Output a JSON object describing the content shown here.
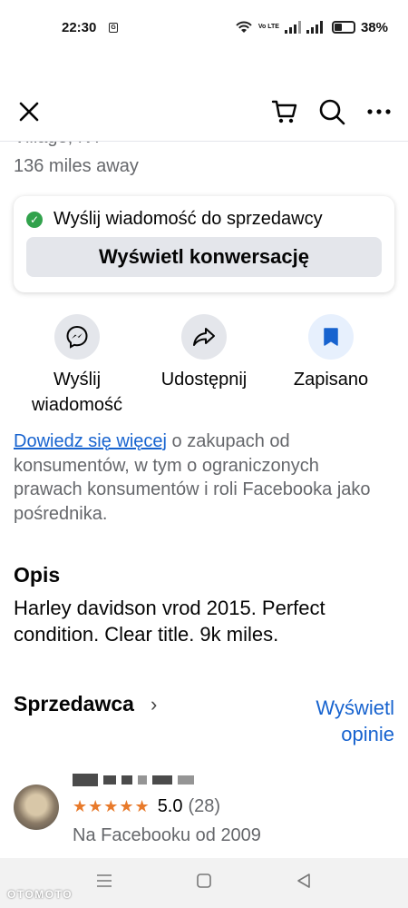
{
  "status_bar": {
    "time": "22:30",
    "sim_badge": "G",
    "network": "Vo LTE",
    "battery": "38%"
  },
  "top_bar": {
    "close": "close-icon",
    "cart": "cart-icon",
    "search": "search-icon",
    "more": "more-icon"
  },
  "listing": {
    "location": "Village, NY",
    "distance": "136 miles away"
  },
  "message_card": {
    "status_text": "Wyślij wiadomość do sprzedawcy",
    "button_label": "Wyświetl konwersację"
  },
  "actions": [
    {
      "label_line1": "Wyślij",
      "label_line2": "wiadomość",
      "icon": "messenger-icon"
    },
    {
      "label_line1": "Udostępnij",
      "label_line2": "",
      "icon": "share-icon"
    },
    {
      "label_line1": "Zapisano",
      "label_line2": "",
      "icon": "bookmark-icon"
    }
  ],
  "info": {
    "link_text": "Dowiedz się więcej",
    "text": " o zakupach od konsumentów, w tym o ograniczonych prawach konsumentów i roli Facebooka jako pośrednika."
  },
  "description": {
    "title": "Opis",
    "body": "Harley davidson vrod 2015. Perfect condition. Clear title. 9k miles."
  },
  "seller": {
    "title": "Sprzedawca",
    "link_line1": "Wyświetl",
    "link_line2": "opinie",
    "rating": "5.0",
    "review_count": "(28)",
    "stars": "★★★★★",
    "since": "Na Facebooku od 2009"
  },
  "watermark": "OTOMOTO",
  "colors": {
    "link": "#1763cf",
    "star": "#e87a2b",
    "check": "#31a24c",
    "button_bg": "#e4e6eb"
  }
}
